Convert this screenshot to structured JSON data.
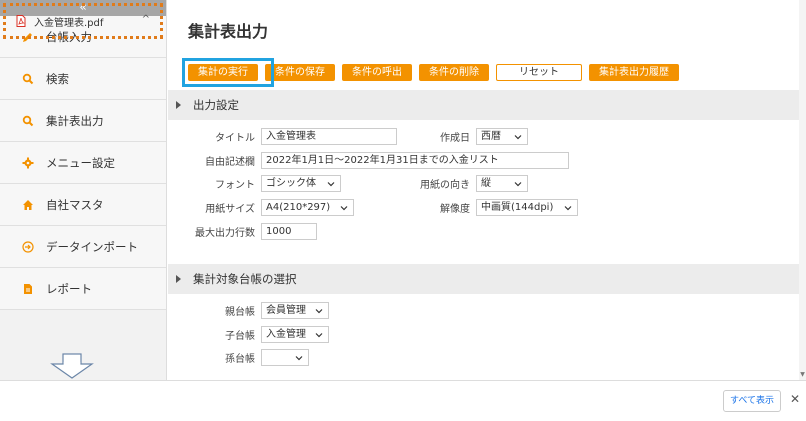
{
  "sidebar": {
    "collapse_label": "«",
    "items": [
      {
        "label": "台帳入力",
        "icon": "pencil-icon"
      },
      {
        "label": "検索",
        "icon": "search-icon"
      },
      {
        "label": "集計表出力",
        "icon": "search-icon"
      },
      {
        "label": "メニュー設定",
        "icon": "gear-icon"
      },
      {
        "label": "自社マスタ",
        "icon": "home-icon"
      },
      {
        "label": "データインポート",
        "icon": "import-icon"
      },
      {
        "label": "レポート",
        "icon": "document-icon"
      }
    ]
  },
  "main": {
    "title": "集計表出力",
    "toolbar": {
      "execute": "集計の実行",
      "save": "条件の保存",
      "load": "条件の呼出",
      "delete": "条件の削除",
      "reset": "リセット",
      "history": "集計表出力履歴"
    },
    "output_section": {
      "header": "出力設定",
      "title_label": "タイトル",
      "title_value": "入金管理表",
      "date_label": "作成日",
      "date_value": "西暦",
      "free_label": "自由記述欄",
      "free_value": "2022年1月1日～2022年1月31日までの入金リスト",
      "font_label": "フォント",
      "font_value": "ゴシック体",
      "orientation_label": "用紙の向き",
      "orientation_value": "縦",
      "paper_label": "用紙サイズ",
      "paper_value": "A4(210*297)",
      "resolution_label": "解像度",
      "resolution_value": "中画質(144dpi)",
      "maxrows_label": "最大出力行数",
      "maxrows_value": "1000"
    },
    "target_section": {
      "header": "集計対象台帳の選択",
      "parent_label": "親台帳",
      "parent_value": "会員管理",
      "child_label": "子台帳",
      "child_value": "入金管理",
      "grandchild_label": "孫台帳",
      "grandchild_value": ""
    }
  },
  "download_bar": {
    "file_name": "入金管理表.pdf",
    "show_all": "すべて表示",
    "close": "✕",
    "caret": "^"
  },
  "colors": {
    "accent": "#f39200",
    "highlight": "#21a3e0",
    "download_highlight": "#e07b1a"
  }
}
